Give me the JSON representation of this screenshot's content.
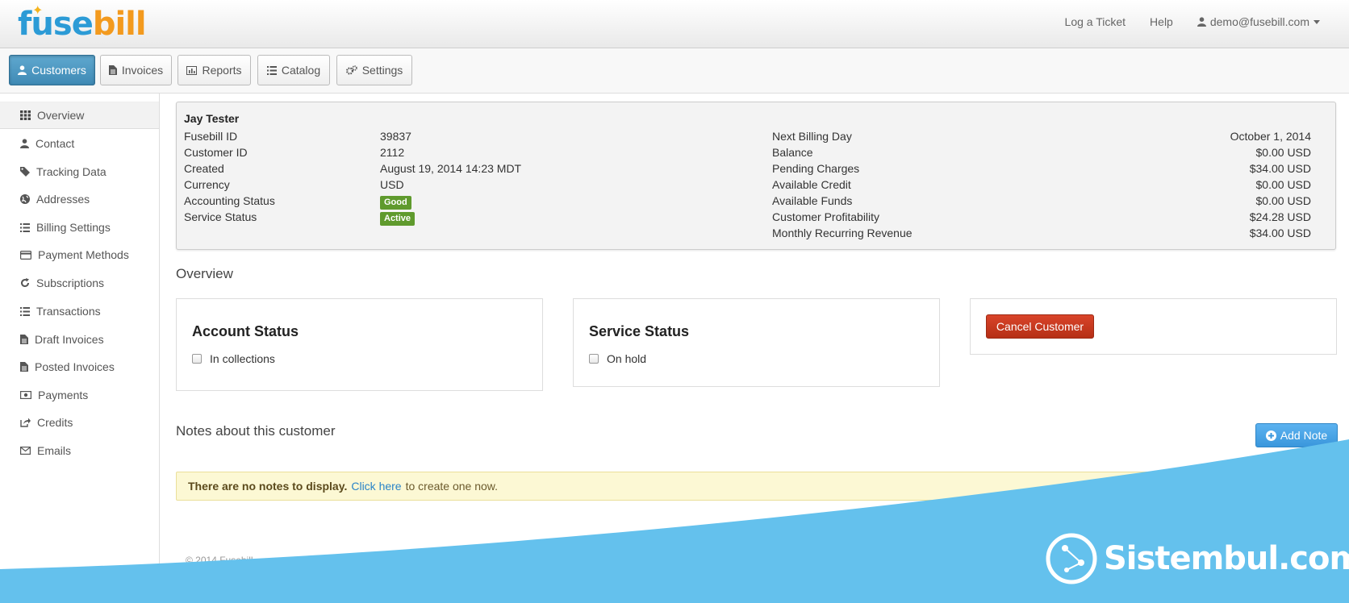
{
  "brand": {
    "name_part1": "fuse",
    "name_part2": "bill"
  },
  "header": {
    "log_ticket": "Log a Ticket",
    "help": "Help",
    "user_email": "demo@fusebill.com"
  },
  "nav": {
    "customers": "Customers",
    "invoices": "Invoices",
    "reports": "Reports",
    "catalog": "Catalog",
    "settings": "Settings"
  },
  "sidebar": {
    "items": [
      {
        "label": "Overview",
        "icon": "grid-icon"
      },
      {
        "label": "Contact",
        "icon": "user-icon"
      },
      {
        "label": "Tracking Data",
        "icon": "tag-icon"
      },
      {
        "label": "Addresses",
        "icon": "globe-icon"
      },
      {
        "label": "Billing Settings",
        "icon": "list-icon"
      },
      {
        "label": "Payment Methods",
        "icon": "credit-card-icon"
      },
      {
        "label": "Subscriptions",
        "icon": "refresh-icon"
      },
      {
        "label": "Transactions",
        "icon": "list-icon"
      },
      {
        "label": "Draft Invoices",
        "icon": "file-icon"
      },
      {
        "label": "Posted Invoices",
        "icon": "file-icon"
      },
      {
        "label": "Payments",
        "icon": "money-icon"
      },
      {
        "label": "Credits",
        "icon": "share-icon"
      },
      {
        "label": "Emails",
        "icon": "envelope-icon"
      }
    ]
  },
  "customer": {
    "name": "Jay Tester",
    "left_fields": [
      {
        "label": "Fusebill ID",
        "value": "39837"
      },
      {
        "label": "Customer ID",
        "value": "2112"
      },
      {
        "label": "Created",
        "value": "August 19, 2014 14:23 MDT"
      },
      {
        "label": "Currency",
        "value": "USD"
      },
      {
        "label": "Accounting Status",
        "value": "Good"
      },
      {
        "label": "Service Status",
        "value": "Active"
      }
    ],
    "right_fields": [
      {
        "label": "Next Billing Day",
        "value": "October 1, 2014"
      },
      {
        "label": "Balance",
        "value": "$0.00 USD"
      },
      {
        "label": "Pending Charges",
        "value": "$34.00 USD"
      },
      {
        "label": "Available Credit",
        "value": "$0.00 USD"
      },
      {
        "label": "Available Funds",
        "value": "$0.00 USD"
      },
      {
        "label": "Customer Profitability",
        "value": "$24.28 USD"
      },
      {
        "label": "Monthly Recurring Revenue",
        "value": "$34.00 USD"
      }
    ]
  },
  "overview": {
    "title": "Overview",
    "account_status": {
      "title": "Account Status",
      "checkbox": "In collections",
      "checked": false
    },
    "service_status": {
      "title": "Service Status",
      "checkbox": "On hold",
      "checked": false
    },
    "cancel_label": "Cancel Customer"
  },
  "notes": {
    "title": "Notes about this customer",
    "add_label": "Add Note",
    "empty_bold": "There are no notes to display.",
    "empty_link": "Click here",
    "empty_rest": "to create one now.",
    "close": "×"
  },
  "footer": {
    "copyright": "© 2014 Fusebill"
  },
  "watermark": {
    "text": "Sistembul.com"
  },
  "colors": {
    "primary": "#3f8ab5",
    "success": "#5f9a2d",
    "danger": "#c0391d",
    "info": "#3a97dc",
    "watermark": "#5dbfeb"
  }
}
